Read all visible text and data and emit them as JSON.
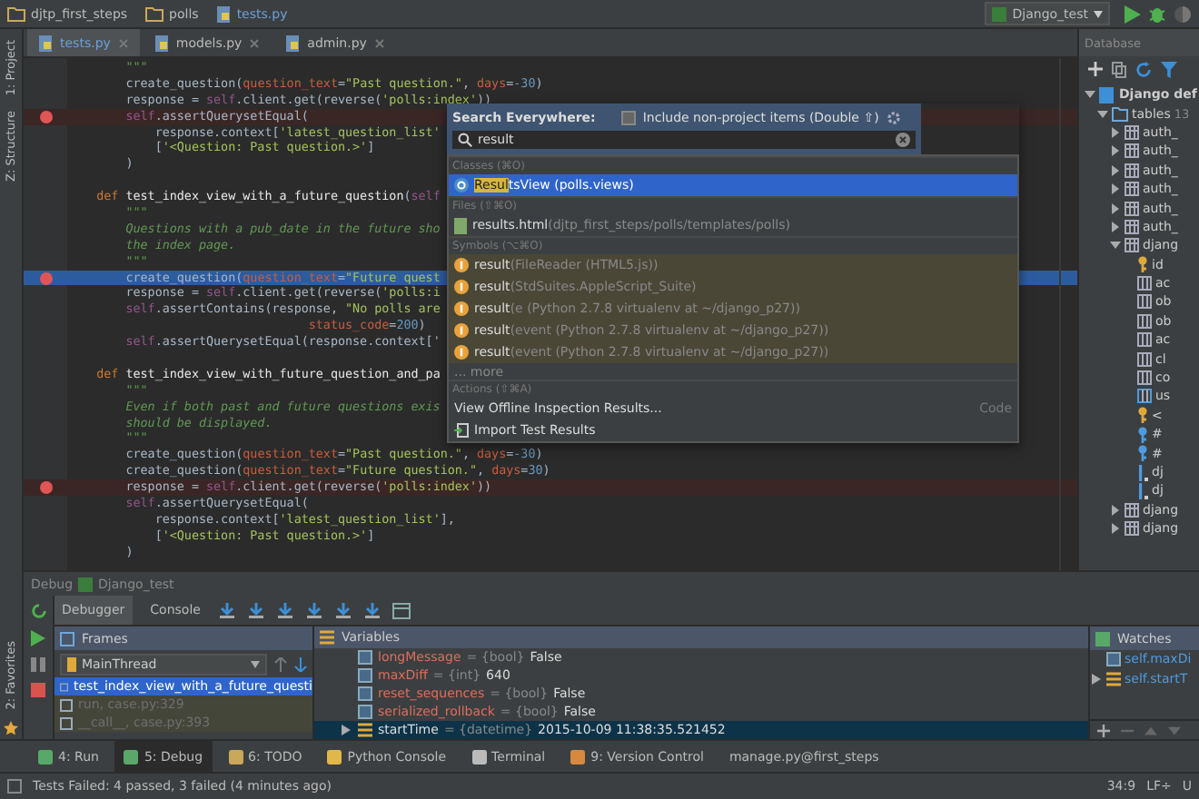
{
  "navbar": {
    "breadcrumb": [
      {
        "label": "djtp_first_steps",
        "kind": "folder"
      },
      {
        "label": "polls",
        "kind": "folder"
      },
      {
        "label": "tests.py",
        "kind": "python"
      }
    ],
    "run_config": "Django_test"
  },
  "tabs": [
    {
      "label": "tests.py",
      "selected": true
    },
    {
      "label": "models.py",
      "selected": false
    },
    {
      "label": "admin.py",
      "selected": false
    }
  ],
  "side_tools": [
    {
      "label": "1: Project"
    },
    {
      "label": "Z: Structure"
    }
  ],
  "side_tools_bottom": [
    {
      "label": "2: Favorites"
    }
  ],
  "editor": {
    "lines": [
      {
        "breakpoint": false,
        "current": false,
        "tokens": [
          {
            "kind": "doc",
            "text": "        \"\"\""
          }
        ]
      },
      {
        "breakpoint": false,
        "current": false,
        "tokens": [
          {
            "kind": "plain",
            "text": "        create_question("
          },
          {
            "kind": "param",
            "text": "question_text"
          },
          {
            "kind": "plain",
            "text": "="
          },
          {
            "kind": "str",
            "text": "\"Past question.\""
          },
          {
            "kind": "plain",
            "text": ", "
          },
          {
            "kind": "param",
            "text": "days"
          },
          {
            "kind": "plain",
            "text": "="
          },
          {
            "kind": "num",
            "text": "-30"
          },
          {
            "kind": "plain",
            "text": ")"
          }
        ]
      },
      {
        "breakpoint": false,
        "current": false,
        "tokens": [
          {
            "kind": "plain",
            "text": "        response = "
          },
          {
            "kind": "self",
            "text": "self"
          },
          {
            "kind": "plain",
            "text": ".client.get(reverse("
          },
          {
            "kind": "str",
            "text": "'polls:index'"
          },
          {
            "kind": "plain",
            "text": "))"
          }
        ]
      },
      {
        "breakpoint": true,
        "current": false,
        "tokens": [
          {
            "kind": "self",
            "text": "        self"
          },
          {
            "kind": "plain",
            "text": ".assertQuerysetEqual("
          }
        ]
      },
      {
        "breakpoint": false,
        "current": false,
        "tokens": [
          {
            "kind": "plain",
            "text": "            response.context["
          },
          {
            "kind": "str",
            "text": "'latest_question_list'"
          }
        ]
      },
      {
        "breakpoint": false,
        "current": false,
        "tokens": [
          {
            "kind": "plain",
            "text": "            ["
          },
          {
            "kind": "str",
            "text": "'<Question: Past question.>'"
          },
          {
            "kind": "plain",
            "text": "]"
          }
        ]
      },
      {
        "breakpoint": false,
        "current": false,
        "tokens": [
          {
            "kind": "plain",
            "text": "        )"
          }
        ]
      },
      {
        "breakpoint": false,
        "current": false
      },
      {
        "breakpoint": false,
        "current": false,
        "tokens": [
          {
            "kind": "kw",
            "text": "    def "
          },
          {
            "kind": "fn",
            "text": "test_index_view_with_a_future_question"
          },
          {
            "kind": "plain",
            "text": "("
          },
          {
            "kind": "self",
            "text": "self"
          }
        ]
      },
      {
        "breakpoint": false,
        "current": false,
        "tokens": [
          {
            "kind": "doc",
            "text": "        \"\"\""
          }
        ]
      },
      {
        "breakpoint": false,
        "current": false,
        "tokens": [
          {
            "kind": "doc",
            "text": "        Questions with a pub_date in the future sho"
          }
        ]
      },
      {
        "breakpoint": false,
        "current": false,
        "tokens": [
          {
            "kind": "doc",
            "text": "        the index page."
          }
        ]
      },
      {
        "breakpoint": false,
        "current": false,
        "tokens": [
          {
            "kind": "doc",
            "text": "        \"\"\""
          }
        ]
      },
      {
        "breakpoint": true,
        "current": true,
        "tokens": [
          {
            "kind": "plain",
            "text": "        create_question("
          },
          {
            "kind": "param",
            "text": "question_text"
          },
          {
            "kind": "plain",
            "text": "="
          },
          {
            "kind": "str",
            "text": "\"Future quest"
          }
        ]
      },
      {
        "breakpoint": false,
        "current": false,
        "tokens": [
          {
            "kind": "plain",
            "text": "        response = "
          },
          {
            "kind": "self",
            "text": "self"
          },
          {
            "kind": "plain",
            "text": ".client.get(reverse("
          },
          {
            "kind": "str",
            "text": "'polls:i"
          }
        ]
      },
      {
        "breakpoint": false,
        "current": false,
        "tokens": [
          {
            "kind": "self",
            "text": "        self"
          },
          {
            "kind": "plain",
            "text": ".assertContains(response, "
          },
          {
            "kind": "str",
            "text": "\"No polls are"
          }
        ]
      },
      {
        "breakpoint": false,
        "current": false,
        "tokens": [
          {
            "kind": "param",
            "text": "                                 status_code"
          },
          {
            "kind": "plain",
            "text": "="
          },
          {
            "kind": "num",
            "text": "200"
          },
          {
            "kind": "plain",
            "text": ")"
          }
        ]
      },
      {
        "breakpoint": false,
        "current": false,
        "tokens": [
          {
            "kind": "self",
            "text": "        self"
          },
          {
            "kind": "plain",
            "text": ".assertQuerysetEqual(response.context['"
          }
        ]
      },
      {
        "breakpoint": false,
        "current": false
      },
      {
        "breakpoint": false,
        "current": false,
        "tokens": [
          {
            "kind": "kw",
            "text": "    def "
          },
          {
            "kind": "fn",
            "text": "test_index_view_with_future_question_and_pa"
          }
        ]
      },
      {
        "breakpoint": false,
        "current": false,
        "tokens": [
          {
            "kind": "doc",
            "text": "        \"\"\""
          }
        ]
      },
      {
        "breakpoint": false,
        "current": false,
        "tokens": [
          {
            "kind": "doc",
            "text": "        Even if both past and future questions exis"
          }
        ]
      },
      {
        "breakpoint": false,
        "current": false,
        "tokens": [
          {
            "kind": "doc",
            "text": "        should be displayed."
          }
        ]
      },
      {
        "breakpoint": false,
        "current": false,
        "tokens": [
          {
            "kind": "doc",
            "text": "        \"\"\""
          }
        ]
      },
      {
        "breakpoint": false,
        "current": false,
        "tokens": [
          {
            "kind": "plain",
            "text": "        create_question("
          },
          {
            "kind": "param",
            "text": "question_text"
          },
          {
            "kind": "plain",
            "text": "="
          },
          {
            "kind": "str",
            "text": "\"Past question.\""
          },
          {
            "kind": "plain",
            "text": ", "
          },
          {
            "kind": "param",
            "text": "days"
          },
          {
            "kind": "plain",
            "text": "="
          },
          {
            "kind": "num",
            "text": "-30"
          },
          {
            "kind": "plain",
            "text": ")"
          }
        ]
      },
      {
        "breakpoint": false,
        "current": false,
        "tokens": [
          {
            "kind": "plain",
            "text": "        create_question("
          },
          {
            "kind": "param",
            "text": "question_text"
          },
          {
            "kind": "plain",
            "text": "="
          },
          {
            "kind": "str",
            "text": "\"Future question.\""
          },
          {
            "kind": "plain",
            "text": ", "
          },
          {
            "kind": "param",
            "text": "days"
          },
          {
            "kind": "plain",
            "text": "="
          },
          {
            "kind": "num",
            "text": "30"
          },
          {
            "kind": "plain",
            "text": ")"
          }
        ]
      },
      {
        "breakpoint": true,
        "current": false,
        "tokens": [
          {
            "kind": "plain",
            "text": "        response = "
          },
          {
            "kind": "self",
            "text": "self"
          },
          {
            "kind": "plain",
            "text": ".client.get(reverse("
          },
          {
            "kind": "str",
            "text": "'polls:index'"
          },
          {
            "kind": "plain",
            "text": "))"
          }
        ]
      },
      {
        "breakpoint": false,
        "current": false,
        "tokens": [
          {
            "kind": "self",
            "text": "        self"
          },
          {
            "kind": "plain",
            "text": ".assertQuerysetEqual("
          }
        ]
      },
      {
        "breakpoint": false,
        "current": false,
        "tokens": [
          {
            "kind": "plain",
            "text": "            response.context["
          },
          {
            "kind": "str",
            "text": "'latest_question_list'"
          },
          {
            "kind": "plain",
            "text": "],"
          }
        ]
      },
      {
        "breakpoint": false,
        "current": false,
        "tokens": [
          {
            "kind": "plain",
            "text": "            ["
          },
          {
            "kind": "str",
            "text": "'<Question: Past question.>'"
          },
          {
            "kind": "plain",
            "text": "]"
          }
        ]
      },
      {
        "breakpoint": false,
        "current": false,
        "tokens": [
          {
            "kind": "plain",
            "text": "        )"
          }
        ]
      }
    ]
  },
  "search_popup": {
    "title": "Search Everywhere:",
    "include_label": "Include non-project items (Double ⇧)",
    "include_checked": false,
    "query": "result",
    "sections": [
      {
        "header": "Classes (⌘O)",
        "items": [
          {
            "kind": "class",
            "selected": true,
            "match": "Resul",
            "text": "tsView (polls.views)"
          }
        ]
      },
      {
        "header": "Files (⇧⌘O)",
        "items": [
          {
            "kind": "file",
            "selected": false,
            "text": "results.html",
            "detail": "(djtp_first_steps/polls/templates/polls)"
          }
        ]
      },
      {
        "header": "Symbols (⌥⌘O)",
        "items": [
          {
            "kind": "symbol",
            "selected": false,
            "text": "result",
            "detail": "(FileReader (HTML5.js))"
          },
          {
            "kind": "symbol",
            "selected": false,
            "text": "result",
            "detail": "(StdSuites.AppleScript_Suite)"
          },
          {
            "kind": "symbol",
            "selected": false,
            "text": "result",
            "detail": "(e (Python 2.7.8 virtualenv at ~/django_p27))"
          },
          {
            "kind": "symbol",
            "selected": false,
            "text": "result",
            "detail": "(event (Python 2.7.8 virtualenv at ~/django_p27))"
          },
          {
            "kind": "symbol",
            "selected": false,
            "text": "result",
            "detail": "(event (Python 2.7.8 virtualenv at ~/django_p27))"
          },
          {
            "kind": "more",
            "selected": false,
            "text": "... more"
          }
        ]
      },
      {
        "header": "Actions (⇧⌘A)",
        "items": [
          {
            "kind": "action",
            "selected": false,
            "text": "View Offline Inspection Results...",
            "shortcut": "Code"
          },
          {
            "kind": "import",
            "selected": false,
            "text": "Import Test Results"
          }
        ]
      }
    ]
  },
  "database": {
    "title": "Database",
    "tree": [
      {
        "kind": "schema",
        "label": "Django def",
        "expanded": true,
        "children": [
          {
            "kind": "folder",
            "label": "tables",
            "count": "13",
            "expanded": true,
            "children": [
              {
                "kind": "table",
                "label": "auth_",
                "expanded": false
              },
              {
                "kind": "table",
                "label": "auth_",
                "expanded": false
              },
              {
                "kind": "table",
                "label": "auth_",
                "expanded": false
              },
              {
                "kind": "table",
                "label": "auth_",
                "expanded": false
              },
              {
                "kind": "table",
                "label": "auth_",
                "expanded": false
              },
              {
                "kind": "table",
                "label": "auth_",
                "expanded": false
              },
              {
                "kind": "table",
                "label": "djang",
                "expanded": true,
                "children": [
                  {
                    "kind": "key",
                    "label": "id"
                  },
                  {
                    "kind": "column",
                    "label": "ac"
                  },
                  {
                    "kind": "column",
                    "label": "ob"
                  },
                  {
                    "kind": "column",
                    "label": "ob"
                  },
                  {
                    "kind": "column",
                    "label": "ac"
                  },
                  {
                    "kind": "column",
                    "label": "cl"
                  },
                  {
                    "kind": "column",
                    "label": "co"
                  },
                  {
                    "kind": "fk",
                    "label": "us"
                  },
                  {
                    "kind": "key",
                    "label": "<"
                  },
                  {
                    "kind": "fkey",
                    "label": "#"
                  },
                  {
                    "kind": "fkey",
                    "label": "#"
                  },
                  {
                    "kind": "index",
                    "label": "dj"
                  },
                  {
                    "kind": "index",
                    "label": "dj"
                  }
                ]
              },
              {
                "kind": "table",
                "label": "djang",
                "expanded": false
              },
              {
                "kind": "table",
                "label": "djang",
                "expanded": false
              }
            ]
          }
        ]
      }
    ]
  },
  "debug": {
    "title": "Debug",
    "config": "Django_test",
    "tabs": [
      {
        "label": "Debugger",
        "selected": true
      },
      {
        "label": "Console",
        "selected": false
      }
    ],
    "frames": {
      "title": "Frames",
      "thread": "MainThread",
      "items": [
        {
          "label": "test_index_view_with_a_future_questi",
          "selected": true,
          "library": false
        },
        {
          "label": "run, case.py:329",
          "selected": false,
          "library": true
        },
        {
          "label": "__call__, case.py:393",
          "selected": false,
          "library": true
        }
      ]
    },
    "variables": {
      "title": "Variables",
      "items": [
        {
          "kind": "primitive",
          "name": "longMessage",
          "sep": "=",
          "type": "{bool}",
          "value": "False",
          "selected": false
        },
        {
          "kind": "primitive",
          "name": "maxDiff",
          "sep": "=",
          "type": "{int}",
          "value": "640",
          "selected": false
        },
        {
          "kind": "primitive",
          "name": "reset_sequences",
          "sep": "=",
          "type": "{bool}",
          "value": "False",
          "selected": false
        },
        {
          "kind": "primitive",
          "name": "serialized_rollback",
          "sep": "=",
          "type": "{bool}",
          "value": "False",
          "selected": false
        },
        {
          "kind": "object",
          "name": "startTime",
          "sep": "=",
          "type": "{datetime}",
          "value": "2015-10-09 11:38:35.521452",
          "selected": true
        }
      ]
    },
    "watches": {
      "title": "Watches",
      "items": [
        {
          "kind": "primitive",
          "name": "self.maxDi"
        },
        {
          "kind": "object",
          "name": "self.startT"
        }
      ]
    }
  },
  "tool_windows": [
    {
      "label": "4: Run",
      "kind": "run",
      "selected": false
    },
    {
      "label": "5: Debug",
      "kind": "debug",
      "selected": true
    },
    {
      "label": "6: TODO",
      "kind": "todo",
      "selected": false
    },
    {
      "label": "Python Console",
      "kind": "console",
      "selected": false
    },
    {
      "label": "Terminal",
      "kind": "terminal",
      "selected": false
    },
    {
      "label": "9: Version Control",
      "kind": "vcs",
      "selected": false
    },
    {
      "label": "manage.py@first_steps",
      "kind": "plain",
      "selected": false
    }
  ],
  "status_bar": {
    "message": "Tests Failed: 4 passed, 3 failed (4 minutes ago)",
    "position": "34:9",
    "line_sep": "LF÷",
    "encoding": "U"
  }
}
